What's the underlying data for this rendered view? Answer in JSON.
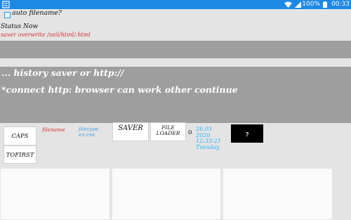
{
  "status_bar": {
    "battery": "100%",
    "time": "00:33",
    "icons": [
      "app-icon",
      "wifi-icon",
      "signal-icon",
      "battery-icon"
    ]
  },
  "options": {
    "auto_filename_label": "auto filename?",
    "auto_filename_checked": false
  },
  "status": {
    "label": "Status Now",
    "value": "saver overwrite /zeil/html/.html"
  },
  "input": {
    "value": ""
  },
  "history": {
    "line1": "... history saver or http://",
    "line2": "*connect http: browser can work other continue"
  },
  "buttons": {
    "caps": "CAPS",
    "tofirst": "TOFIRST",
    "saver": "SAVER",
    "file_loader_line1": "FILE",
    "file_loader_line2": "LOADER",
    "help": "?"
  },
  "fields": {
    "filename": "filename",
    "filetype_line1": "filetype",
    "filetype_line2": "ex:css",
    "counter": "0"
  },
  "datetime": {
    "date": "26.05",
    "year": "2020",
    "time": "12:33:21",
    "weekday": "Tuesday"
  },
  "colors": {
    "status_bar": "#1e88e5",
    "gray_bar": "#9e9e9e",
    "red_text": "#d32f2f",
    "blue_text": "#4aa3df",
    "cyan_text": "#29b6f6"
  }
}
